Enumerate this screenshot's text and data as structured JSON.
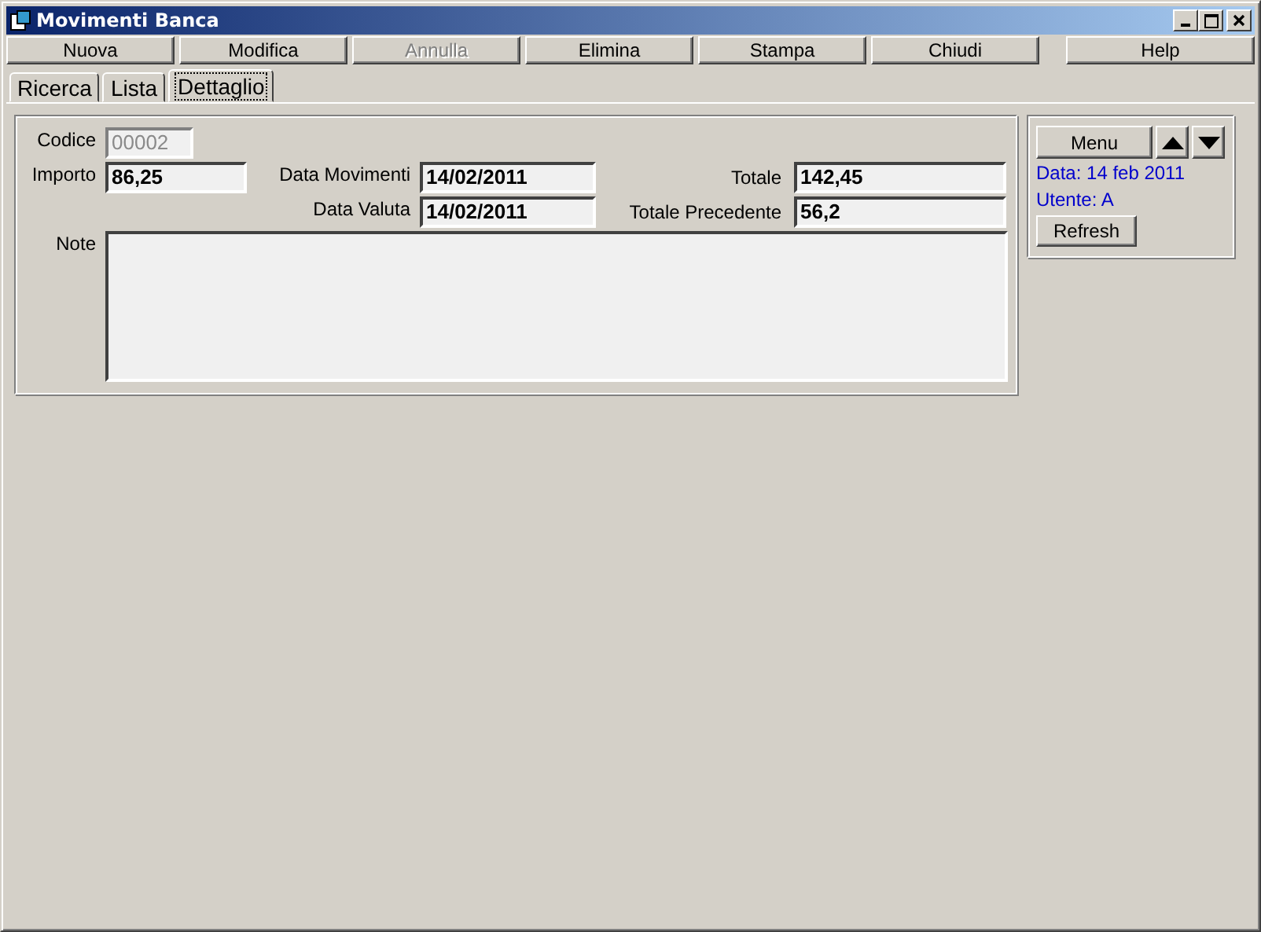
{
  "window": {
    "title": "Movimenti Banca"
  },
  "toolbar": [
    {
      "label": "Nuova",
      "disabled": false
    },
    {
      "label": "Modifica",
      "disabled": false
    },
    {
      "label": "Annulla",
      "disabled": true
    },
    {
      "label": "Elimina",
      "disabled": false
    },
    {
      "label": "Stampa",
      "disabled": false
    },
    {
      "label": "Chiudi",
      "disabled": false
    }
  ],
  "help_button": {
    "label": "Help"
  },
  "tabs": [
    {
      "label": "Ricerca",
      "selected": false
    },
    {
      "label": "Lista",
      "selected": false
    },
    {
      "label": "Dettaglio",
      "selected": true
    }
  ],
  "form": {
    "codice": {
      "label": "Codice",
      "value": "00002",
      "disabled": true
    },
    "importo": {
      "label": "Importo",
      "value": "86,25",
      "disabled": false
    },
    "data_movimenti": {
      "label": "Data Movimenti",
      "value": "14/02/2011",
      "disabled": false
    },
    "totale": {
      "label": "Totale",
      "value": "142,45",
      "disabled": false
    },
    "data_valuta": {
      "label": "Data Valuta",
      "value": "14/02/2011",
      "disabled": false
    },
    "totale_precedente": {
      "label": "Totale Precedente",
      "value": "56,2",
      "disabled": false
    },
    "note": {
      "label": "Note",
      "disabled": false
    }
  },
  "side_panel": {
    "menu_button": "Menu",
    "info": [
      "Data: 14 feb 2011",
      "Utente: A"
    ],
    "refresh_button": "Refresh"
  }
}
